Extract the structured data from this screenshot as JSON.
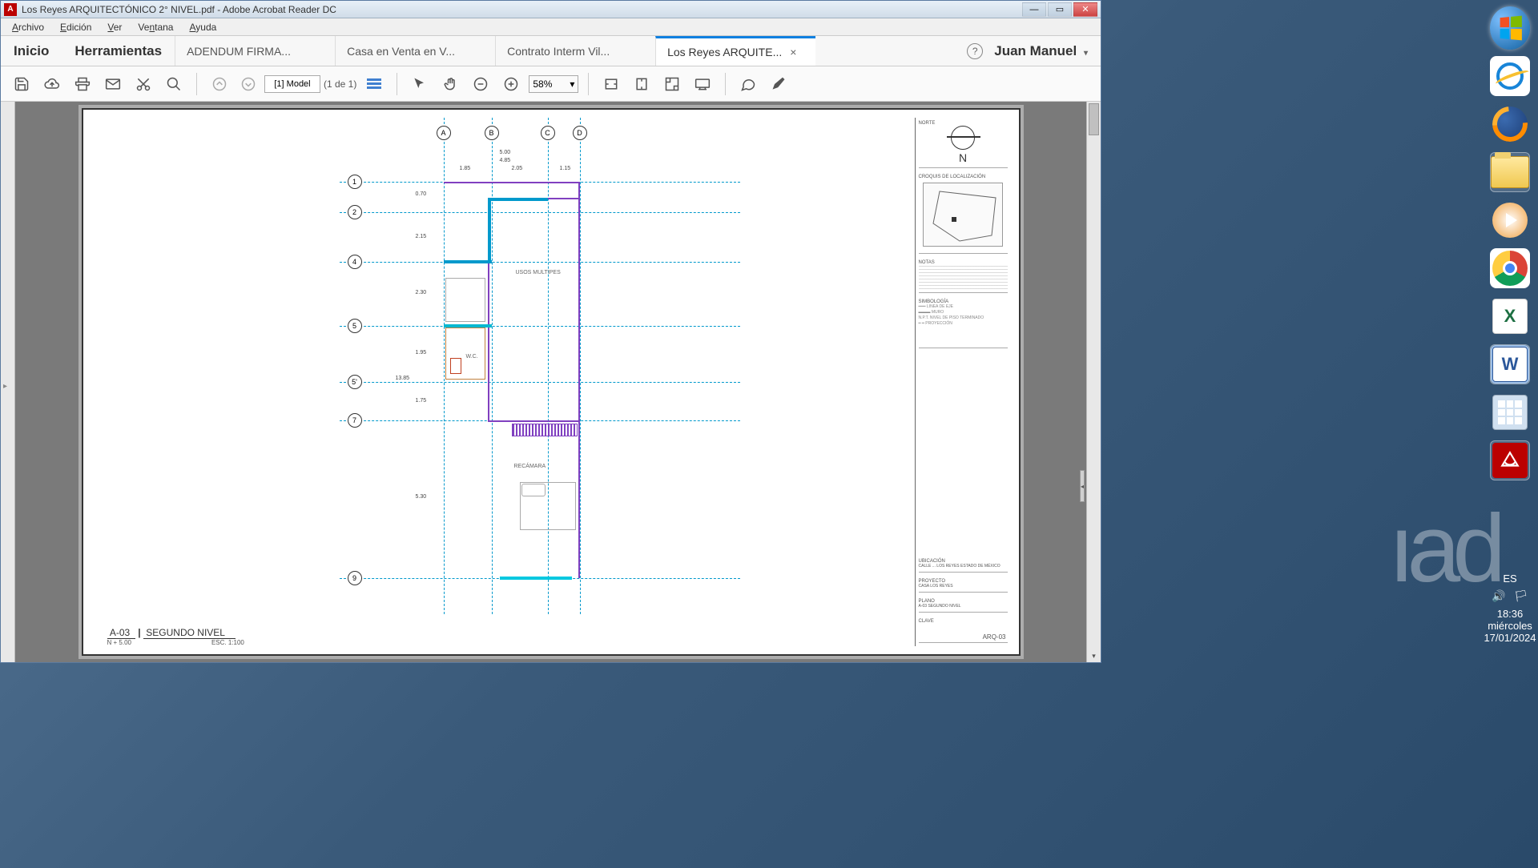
{
  "titlebar": {
    "text": "Los Reyes ARQUITECTÓNICO 2° NIVEL.pdf - Adobe Acrobat Reader DC"
  },
  "menubar": {
    "items": [
      "Archivo",
      "Edición",
      "Ver",
      "Ventana",
      "Ayuda"
    ]
  },
  "nav": {
    "inicio": "Inicio",
    "herramientas": "Herramientas"
  },
  "tabs": [
    {
      "label": "ADENDUM FIRMA...",
      "active": false
    },
    {
      "label": "Casa en Venta en V...",
      "active": false
    },
    {
      "label": "Contrato Interm Vil...",
      "active": false
    },
    {
      "label": "Los Reyes ARQUITE...",
      "active": true
    }
  ],
  "user": "Juan Manuel",
  "toolbar": {
    "page_input": "[1] Model",
    "page_count": "(1 de 1)",
    "zoom": "58%"
  },
  "plan": {
    "v_axes": [
      "A",
      "B",
      "C",
      "D"
    ],
    "h_axes": [
      "1",
      "2",
      "4",
      "5",
      "5'",
      "7",
      "9"
    ],
    "dims_top": [
      "5.00",
      "4.85",
      "1.85",
      "2.05",
      "1.15"
    ],
    "dims_left": [
      "0.70",
      "2.15",
      "2.30",
      "1.95",
      "13.85",
      "1.75",
      "5.30"
    ],
    "rooms": {
      "usos": "USOS MULTIPES",
      "wc": "W.C.",
      "recamara": "RECÁMARA"
    }
  },
  "titleblock": {
    "norte": "NORTE",
    "n": "N",
    "croquis": "CROQUIS DE LOCALIZACIÓN",
    "notas": "NOTAS",
    "simbologia": "SIMBOLOGÍA",
    "ubicacion_label": "UBICACIÓN",
    "ubicacion": "CALLE ... LOS REYES ESTADO DE MÉXICO",
    "proyecto_label": "PROYECTO",
    "proyecto": "CASA LOS REYES",
    "plano_label": "PLANO",
    "plano": "A-03 SEGUNDO NIVEL",
    "clave_label": "CLAVE",
    "arq": "ARQ-03"
  },
  "footer": {
    "code": "A-03",
    "title": "SEGUNDO NIVEL",
    "level": "N + 5.00",
    "scale": "ESC. 1:100"
  },
  "tray": {
    "lang": "ES",
    "time": "18:36",
    "day": "miércoles",
    "date": "17/01/2024"
  }
}
